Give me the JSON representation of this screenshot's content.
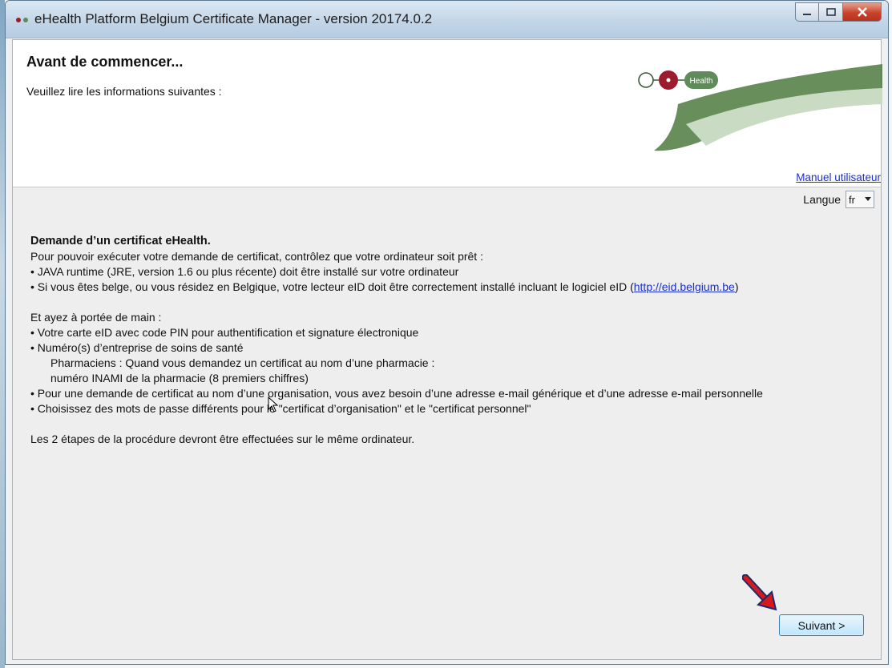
{
  "window": {
    "title": "eHealth Platform Belgium Certificate Manager - version 20174.0.2"
  },
  "header": {
    "title": "Avant de commencer...",
    "subtitle": "Veuillez lire les informations suivantes :",
    "logo_text": "Health",
    "manual_link": "Manuel utilisateur"
  },
  "language": {
    "label": "Langue",
    "selected": "fr"
  },
  "content": {
    "title": "Demande d’un certificat eHealth.",
    "intro": "Pour pouvoir exécuter votre demande de certificat, contrôlez que votre ordinateur soit prêt :",
    "req1": "• JAVA runtime (JRE, version 1.6 ou plus récente) doit être installé sur votre ordinateur",
    "req2_prefix": "• Si vous êtes belge, ou vous résidez en Belgique, votre lecteur eID doit être correctement installé incluant le logiciel eID (",
    "req2_link": "http://eid.belgium.be",
    "req2_suffix": ")",
    "handy_intro": "Et ayez à portée de main :",
    "item1": "• Votre carte eID avec code PIN pour authentification et signature électronique",
    "item2": "• Numéro(s) d’entreprise de soins de santé",
    "item2_sub1": "Pharmaciens : Quand vous demandez un certificat au nom d’une pharmacie :",
    "item2_sub2": "numéro INAMI de la pharmacie (8 premiers chiffres)",
    "item3": "• Pour une demande de certificat au nom d’une organisation, vous avez besoin d’une adresse e-mail générique et d’une adresse e-mail personnelle",
    "item4": "• Choisissez des mots de passe différents pour le \"certificat d’organisation\" et le \"certificat personnel\"",
    "footer_note": "Les 2 étapes de la procédure devront être effectuées sur le même ordinateur."
  },
  "buttons": {
    "next": "Suivant >"
  },
  "colors": {
    "link": "#1a2fd0",
    "logo_green": "#5f8a5a",
    "logo_red": "#9b1c2c",
    "annotation_arrow": "#d7191c"
  }
}
